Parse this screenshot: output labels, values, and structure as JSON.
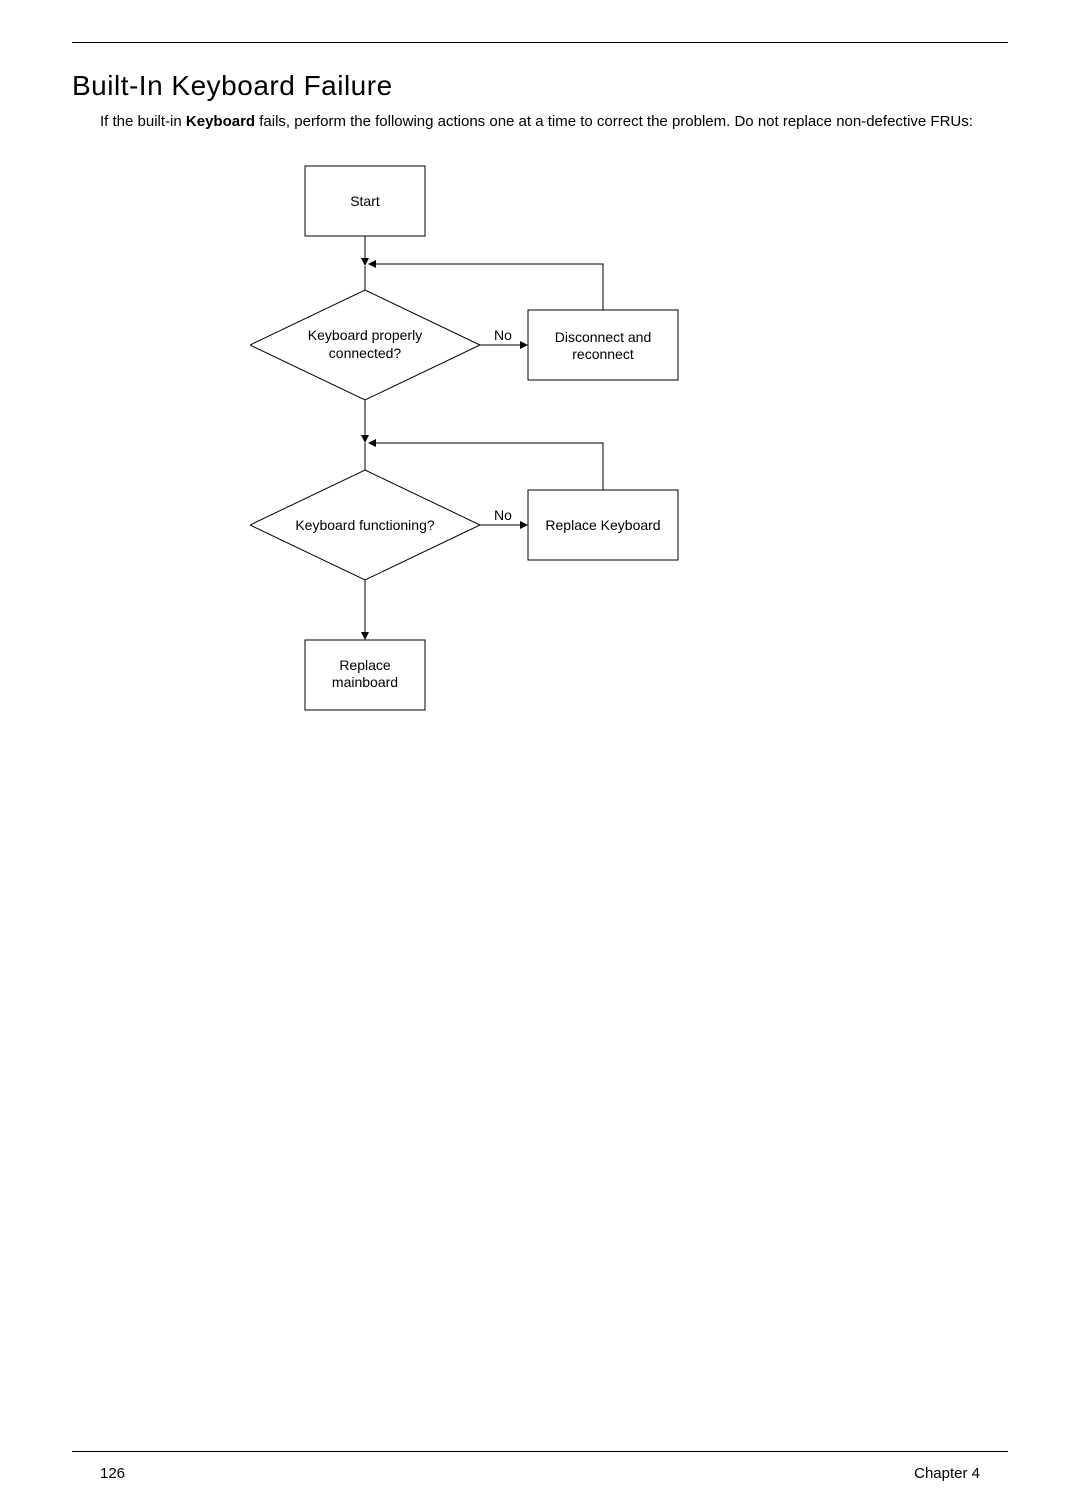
{
  "heading": "Built-In Keyboard Failure",
  "intro_before_bold": "If the built-in ",
  "intro_bold": "Keyboard",
  "intro_after_bold": " fails, perform the following actions one at a time to correct the problem. Do not replace non-defective FRUs:",
  "flow": {
    "start": "Start",
    "q1": "Keyboard properly connected?",
    "q1_line1": "Keyboard properly",
    "q1_line2": "connected?",
    "q1_edge": "No",
    "action1_line1": "Disconnect and",
    "action1_line2": "reconnect",
    "q2": "Keyboard functioning?",
    "q2_edge": "No",
    "action2": "Replace Keyboard",
    "end_line1": "Replace",
    "end_line2": "mainboard"
  },
  "footer": {
    "page": "126",
    "chapter": "Chapter 4"
  }
}
